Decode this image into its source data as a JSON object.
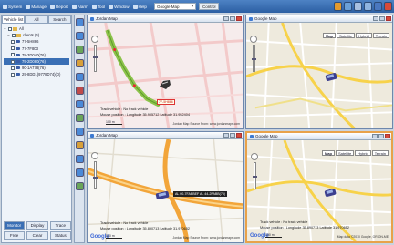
{
  "menu": {
    "items": [
      {
        "label": "System",
        "icon": "system-icon"
      },
      {
        "label": "Manage",
        "icon": "manage-icon"
      },
      {
        "label": "Report",
        "icon": "report-icon"
      },
      {
        "label": "Alarm",
        "icon": "alarm-icon"
      },
      {
        "label": "Tool",
        "icon": "tool-icon"
      },
      {
        "label": "Window",
        "icon": "window-icon"
      },
      {
        "label": "Help",
        "icon": "help-icon"
      }
    ],
    "map_select": "Google Map",
    "control_button": "Control",
    "right_icon_colors": [
      "#e39a2e",
      "#6aa0d8",
      "#a8c0e0",
      "#8fb4e0",
      "#4a78c0",
      "#d64a3a"
    ]
  },
  "left_panel": {
    "tabs": [
      "Vehicle list",
      "All",
      "Search"
    ],
    "tree": [
      {
        "label": "All",
        "type": "root"
      },
      {
        "label": "clients (6)",
        "type": "group"
      },
      {
        "label": "77-5H866",
        "type": "vehicle"
      },
      {
        "label": "77-7F803",
        "type": "vehicle"
      },
      {
        "label": "78-3D040(76)",
        "type": "vehicle"
      },
      {
        "label": "79-2D080(76)",
        "type": "vehicle",
        "selected": true
      },
      {
        "label": "90-1A778(76)",
        "type": "vehicle"
      },
      {
        "label": "29-8DD1(9778D74)(D)",
        "type": "vehicle"
      }
    ],
    "buttons": [
      {
        "label": "Monitor",
        "active": true
      },
      {
        "label": "Display",
        "active": false
      },
      {
        "label": "Trace",
        "active": false
      },
      {
        "label": "Free",
        "active": false
      },
      {
        "label": "Clear",
        "active": false
      },
      {
        "label": "Status",
        "active": false
      }
    ]
  },
  "toolstrip": {
    "tools": [
      "zoom-in-icon",
      "zoom-out-icon",
      "pan-icon",
      "measure-icon",
      "refresh-icon",
      "locate-icon",
      "edit-icon",
      "route-icon",
      "info-icon",
      "print-icon",
      "export-icon",
      "settings-icon",
      "layers-icon"
    ],
    "colors": [
      "#4b8ad8",
      "#4b8ad8",
      "#6aa55a",
      "#d8a03a",
      "#4b8ad8",
      "#c04a4a",
      "#4b8ad8",
      "#6aa55a",
      "#4b8ad8",
      "#d8a03a",
      "#4b8ad8",
      "#4b8ad8",
      "#6aa55a"
    ]
  },
  "maps": [
    {
      "title": "Jordan Map",
      "vehicle_label": "77-5H866",
      "info": [
        "Track vehicle : No track vehicle",
        "Mouse position : Longitude 35.905712 Latitude 31.952404"
      ],
      "copyright": "Jordan Map Source From: www.jordanmaps.com",
      "scale": "100 m",
      "map_types": [],
      "google_logo": "",
      "highlighted": false
    },
    {
      "title": "Google Map",
      "vehicle_label": "",
      "info": [],
      "copyright": "",
      "scale": "",
      "map_types": [
        "Map",
        "Satellite",
        "Hybrid",
        "Terrain"
      ],
      "google_logo": "",
      "highlighted": false
    },
    {
      "title": "Jordan Map",
      "vehicle_label": "AL 00-7FABBEF AL 44-2FABB(76)",
      "info": [
        "Track vehicle : No track vehicle",
        "Mouse position : Longitude 35.890713 Latitude 31.970652"
      ],
      "copyright": "Jordan Map Source From: www.jordanmaps.com",
      "scale": "100 m",
      "map_types": [],
      "google_logo": "Google",
      "highlighted": false
    },
    {
      "title": "Google Map",
      "vehicle_label": "",
      "info": [
        "Track vehicle : No track vehicle",
        "Mouse position : Longitude 35.890713 Latitude 31.970652"
      ],
      "copyright": "Map data ©2010 Google, ORION-ME",
      "scale": "100 m",
      "map_types": [
        "Map",
        "Satellite",
        "Hybrid",
        "Terrain"
      ],
      "google_logo": "Google",
      "highlighted": true
    }
  ]
}
